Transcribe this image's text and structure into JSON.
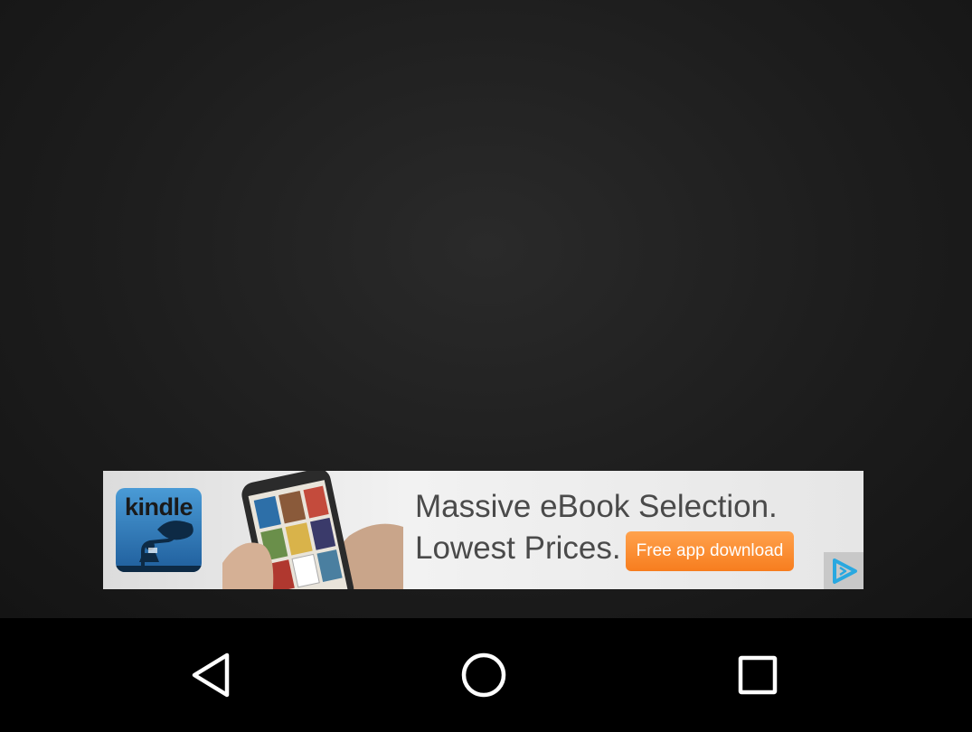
{
  "ad": {
    "brand": "kindle",
    "headline": "Massive eBook Selection.",
    "subline": "Lowest Prices.",
    "cta": "Free app download",
    "adchoices_icon": "adchoices-play-icon",
    "colors": {
      "cta": "#f7821f",
      "kindle_bg": "#2f78b8",
      "adchoices": "#29a8e0"
    }
  },
  "nav": {
    "back_icon": "triangle-back-icon",
    "home_icon": "circle-home-icon",
    "recents_icon": "square-recents-icon"
  }
}
